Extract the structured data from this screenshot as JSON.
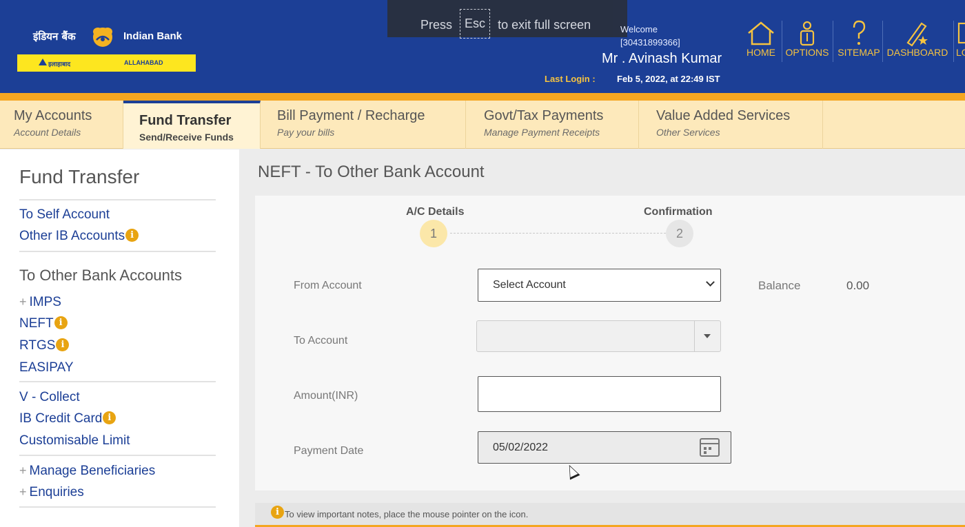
{
  "header": {
    "bank_name_hindi": "इंडियन बैंक",
    "bank_name": "Indian Bank",
    "strip_hindi": "इलाहाबाद",
    "strip_english": "ALLAHABAD",
    "fullscreen_notice": {
      "before": "Press",
      "key": "Esc",
      "after": "to exit full screen"
    },
    "welcome": "Welcome",
    "customer_id": "[30431899366]",
    "customer_name": "Mr . Avinash Kumar",
    "last_login_label": "Last Login :",
    "last_login_value": "Feb 5, 2022, at 22:49 IST",
    "nav": [
      {
        "label": "HOME",
        "icon": "home-icon"
      },
      {
        "label": "OPTIONS",
        "icon": "options-icon"
      },
      {
        "label": "SITEMAP",
        "icon": "sitemap-icon"
      },
      {
        "label": "DASHBOARD",
        "icon": "dashboard-icon"
      },
      {
        "label": "LO",
        "icon": "logout-icon"
      }
    ]
  },
  "tabs": [
    {
      "title": "My Accounts",
      "subtitle": "Account Details"
    },
    {
      "title": "Fund Transfer",
      "subtitle": "Send/Receive Funds",
      "active": true
    },
    {
      "title": "Bill Payment / Recharge",
      "subtitle": "Pay your bills"
    },
    {
      "title": "Govt/Tax Payments",
      "subtitle": "Manage Payment Receipts"
    },
    {
      "title": "Value Added Services",
      "subtitle": "Other Services"
    }
  ],
  "sidebar": {
    "title": "Fund Transfer",
    "self_account": "To Self Account",
    "other_ib": "Other IB Accounts",
    "other_bank_heading": "To Other Bank Accounts",
    "imps": "IMPS",
    "neft": "NEFT",
    "rtgs": "RTGS",
    "easipay": "EASIPAY",
    "vcollect": "V - Collect",
    "ib_credit_card": "IB Credit Card",
    "custom_limit": "Customisable Limit",
    "manage_beneficiaries": "Manage Beneficiaries",
    "enquiries": "Enquiries",
    "plus": "+",
    "info_glyph": "i"
  },
  "main": {
    "title": "NEFT - To Other Bank Account",
    "steps": [
      {
        "label": "A/C Details",
        "number": "1",
        "active": true
      },
      {
        "label": "Confirmation",
        "number": "2",
        "active": false
      }
    ],
    "from_account_label": "From Account",
    "from_account_value": "Select Account",
    "balance_label": "Balance",
    "balance_value": "0.00",
    "to_account_label": "To Account",
    "amount_label": "Amount(INR)",
    "amount_value": "",
    "payment_date_label": "Payment Date",
    "payment_date_value": "05/02/2022",
    "note": "To view important notes, place the mouse pointer on the icon."
  },
  "colors": {
    "header_blue": "#1c3f96",
    "accent_orange": "#f4a621",
    "tab_bg": "#fde9bb",
    "link_blue": "#1c3f96",
    "gold": "#f6c340",
    "info_orange": "#e8a412",
    "step_active": "#fbe7a9"
  }
}
